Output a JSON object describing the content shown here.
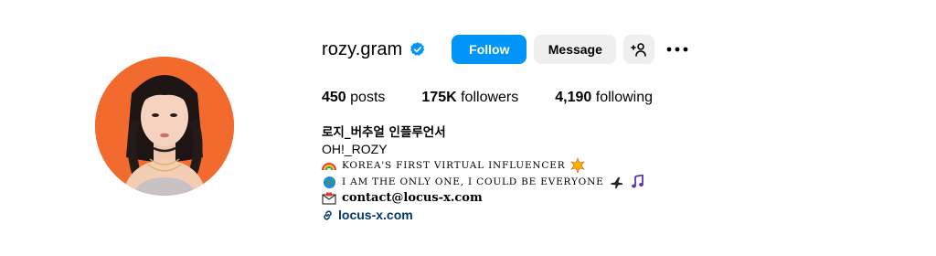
{
  "profile": {
    "username": "rozy.gram",
    "follow_label": "Follow",
    "message_label": "Message",
    "add_user_label": "+ 👤",
    "more_label": "•••"
  },
  "stats": {
    "posts_count": "450",
    "posts_label": "posts",
    "followers_count": "175K",
    "followers_label": "followers",
    "following_count": "4,190",
    "following_label": "following"
  },
  "bio": {
    "full_name": "로지_버추얼 인플루언서",
    "category": "OH!_ROZY",
    "line1_text": "KOREA'S FIRST VIRTUAL INFLUENCER",
    "line2_text": "I AM THE ONLY ONE, I COULD BE EVERYONE",
    "contact": "contact@locus-x.com",
    "link": "locus-x.com"
  },
  "colors": {
    "follow": "#0095f6",
    "verified": "#0095f6",
    "secondary_button": "#efefef",
    "link": "#00376b",
    "avatar_background": "#f26a2e"
  },
  "icons": [
    "verified-badge-icon",
    "add-user-icon",
    "more-options-icon",
    "rainbow-icon",
    "sparkle-icon",
    "globe-icon",
    "airplane-icon",
    "music-notes-icon",
    "envelope-icon",
    "link-icon"
  ]
}
